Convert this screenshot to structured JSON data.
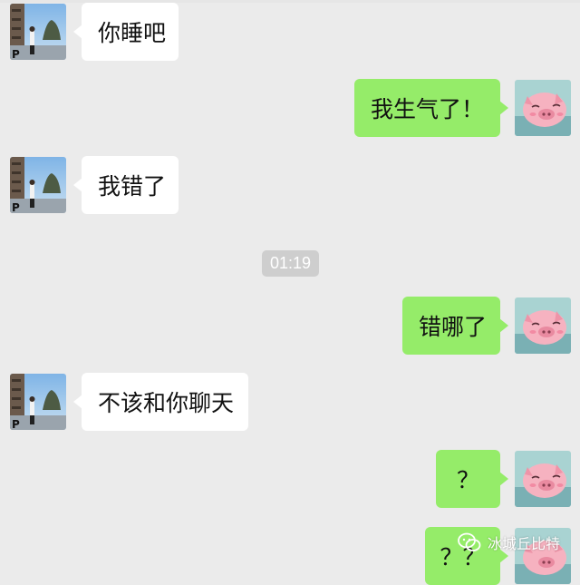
{
  "chat": {
    "timestamp": "01:19",
    "messages": [
      {
        "side": "in",
        "text": "你睡吧",
        "avatar": "person-photo-avatar"
      },
      {
        "side": "out",
        "text": "我生气了！",
        "avatar": "pink-pig-avatar"
      },
      {
        "side": "in",
        "text": "我错了",
        "avatar": "person-photo-avatar"
      },
      {
        "side": "out",
        "text": "错哪了",
        "avatar": "pink-pig-avatar"
      },
      {
        "side": "in",
        "text": "不该和你聊天",
        "avatar": "person-photo-avatar"
      },
      {
        "side": "out",
        "text": "？",
        "avatar": "pink-pig-avatar"
      },
      {
        "side": "out",
        "text": "？？",
        "avatar": "pink-pig-avatar"
      }
    ]
  },
  "watermark": {
    "text": "冰城丘比特",
    "icon": "wechat-official-account-icon"
  },
  "colors": {
    "background": "#ebebeb",
    "incoming_bubble": "#ffffff",
    "outgoing_bubble": "#95ec69",
    "timestamp_bg": "#cecece"
  }
}
